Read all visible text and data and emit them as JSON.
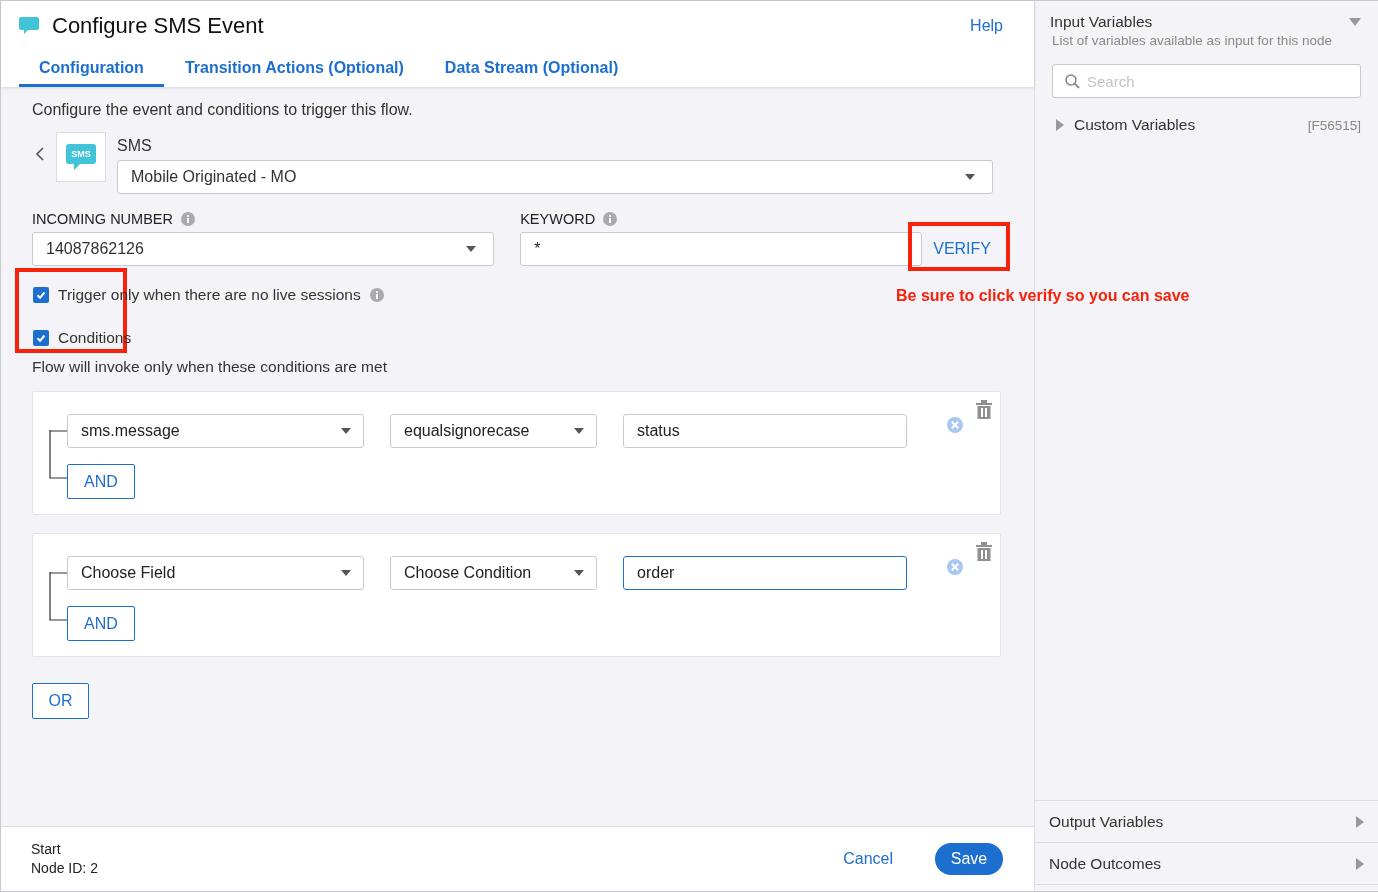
{
  "header": {
    "title": "Configure SMS Event",
    "help": "Help"
  },
  "tabs": [
    {
      "label": "Configuration",
      "selected": true
    },
    {
      "label": "Transition Actions (Optional)",
      "selected": false
    },
    {
      "label": "Data Stream (Optional)",
      "selected": false
    }
  ],
  "intro": "Configure the event and conditions to trigger this flow.",
  "event": {
    "label": "SMS",
    "icon_text": "SMS",
    "value": "Mobile Originated - MO"
  },
  "incoming_number": {
    "label": "INCOMING NUMBER",
    "value": "14087862126"
  },
  "keyword": {
    "label": "KEYWORD",
    "value": "*",
    "button": "VERIFY",
    "highlighted": true
  },
  "annotation_note": "Be sure to click verify so you can save",
  "checkboxes_highlighted": true,
  "checkboxes": [
    {
      "label": "Trigger only when there are no live sessions",
      "checked": true,
      "info": true
    },
    {
      "label": "Conditions",
      "checked": true,
      "info": false
    }
  ],
  "conditions_note": "Flow will invoke only when these conditions are met",
  "condition_groups": [
    {
      "field": "sms.message",
      "condition": "equalsignorecase",
      "value": "status",
      "focused": false,
      "and_button": "AND"
    },
    {
      "field": "Choose Field",
      "condition": "Choose Condition",
      "value": "order",
      "focused": true,
      "and_button": "AND"
    }
  ],
  "or_button": "OR",
  "footer": {
    "node_type": "Start",
    "node_id": "Node ID: 2",
    "cancel": "Cancel",
    "save": "Save"
  },
  "side_panel": {
    "title": "Input Variables",
    "expanded": true,
    "subtitle": "List of variables available as input for this node",
    "search_placeholder": "Search",
    "tree": [
      {
        "label": "Custom Variables",
        "tag": "[F56515]",
        "expanded": false
      }
    ],
    "sections": [
      {
        "label": "Output Variables",
        "expanded": false
      },
      {
        "label": "Node Outcomes",
        "expanded": false
      }
    ]
  }
}
